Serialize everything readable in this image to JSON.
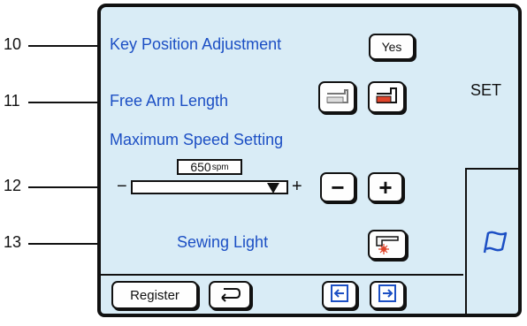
{
  "callouts": {
    "c10": "10",
    "c11": "11",
    "c12": "12",
    "c13": "13"
  },
  "settings": {
    "key_position_label": "Key Position Adjustment",
    "key_position_button": "Yes",
    "free_arm_label": "Free Arm Length",
    "max_speed_label": "Maximum Speed Setting",
    "speed_value": "650",
    "speed_unit": "spm",
    "speed_slider_level": 0.95,
    "minus_label": "−",
    "plus_label": "+",
    "sewing_light_label": "Sewing Light"
  },
  "side": {
    "set_label": "SET",
    "flag_icon": "flag-icon"
  },
  "bottom": {
    "register_label": "Register",
    "back_icon": "return-arrow-icon",
    "prev_icon": "page-prev-icon",
    "next_icon": "page-next-icon"
  },
  "colors": {
    "panel_bg": "#d9ecf6",
    "label_blue": "#1c4fc4",
    "light_red": "#e0442a"
  }
}
